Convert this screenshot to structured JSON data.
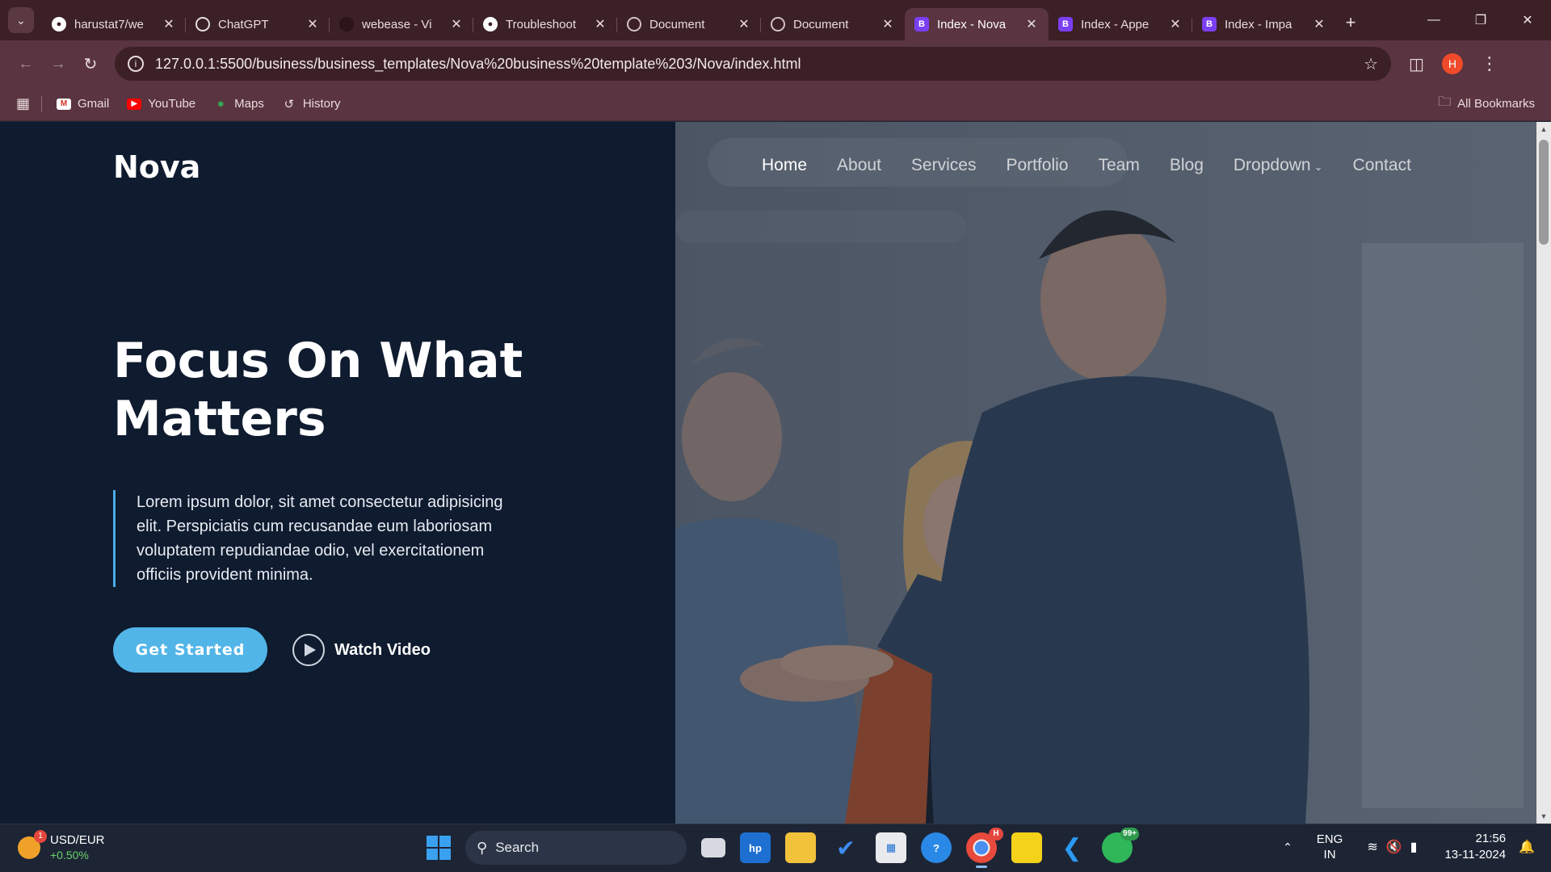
{
  "browser": {
    "tabs": [
      {
        "title": "harustat7/we",
        "favicon": "github-icon",
        "active": false
      },
      {
        "title": "ChatGPT",
        "favicon": "chatgpt-icon",
        "active": false
      },
      {
        "title": "webease - Vi",
        "favicon": "github-icon",
        "active": false
      },
      {
        "title": "Troubleshoot",
        "favicon": "github-icon",
        "active": false
      },
      {
        "title": "Document",
        "favicon": "globe-icon",
        "active": false
      },
      {
        "title": "Document",
        "favicon": "globe-icon",
        "active": false
      },
      {
        "title": "Index - Nova",
        "favicon": "bootstrap-icon",
        "active": true
      },
      {
        "title": "Index - Appe",
        "favicon": "bootstrap-icon",
        "active": false
      },
      {
        "title": "Index - Impa",
        "favicon": "bootstrap-icon",
        "active": false
      }
    ],
    "url": "127.0.0.1:5500/business/business_templates/Nova%20business%20template%203/Nova/index.html",
    "profile_initial": "H",
    "bookmarks": [
      {
        "label": "Gmail",
        "icon": "gmail-icon"
      },
      {
        "label": "YouTube",
        "icon": "youtube-icon"
      },
      {
        "label": "Maps",
        "icon": "maps-icon"
      },
      {
        "label": "History",
        "icon": "history-icon"
      }
    ],
    "all_bookmarks_label": "All Bookmarks"
  },
  "site": {
    "logo": "Nova",
    "nav": [
      "Home",
      "About",
      "Services",
      "Portfolio",
      "Team",
      "Blog",
      "Dropdown",
      "Contact"
    ],
    "active_nav": "Home",
    "headline": "Focus On What Matters",
    "lede": "Lorem ipsum dolor, sit amet consectetur adipisicing elit. Perspiciatis cum recusandae eum laboriosam voluptatem repudiandae odio, vel exercitationem officiis provident minima.",
    "cta_primary": "Get Started",
    "cta_secondary": "Watch Video",
    "colors": {
      "left_panel": "#0f1b2f",
      "accent": "#52b5e8"
    }
  },
  "taskbar": {
    "widget_title": "USD/EUR",
    "widget_change": "+0.50%",
    "widget_badge": "1",
    "search_placeholder": "Search",
    "chrome_badge": "H",
    "whatsapp_badge": "99+",
    "lang_top": "ENG",
    "lang_bottom": "IN",
    "time": "21:56",
    "date": "13-11-2024"
  }
}
